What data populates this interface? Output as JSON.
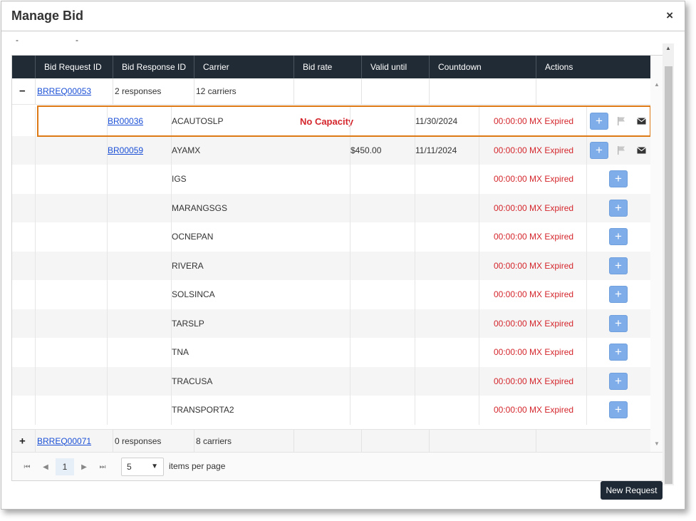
{
  "dialog": {
    "title": "Manage Bid",
    "close_symbol": "×",
    "dash_a": "-",
    "dash_b": "-"
  },
  "grid": {
    "columns": [
      "Bid Request ID",
      "Bid Response ID",
      "Carrier",
      "Bid rate",
      "Valid until",
      "Countdown",
      "Actions"
    ],
    "group1": {
      "toggle": "−",
      "request_id": "BRREQ00053",
      "responses": "2 responses",
      "carriers": "12 carriers"
    },
    "group2": {
      "toggle": "+",
      "request_id": "BRREQ00071",
      "responses": "0 responses",
      "carriers": "8 carriers"
    },
    "detail_rows": [
      {
        "response_id": "BR00036",
        "carrier": "ACAUTOSLP",
        "status": "No Capacity",
        "bid_rate": "",
        "valid_until": "11/30/2024",
        "countdown": "00:00:00 MX Expired",
        "add": "+"
      },
      {
        "response_id": "BR00059",
        "carrier": "AYAMX",
        "status": "",
        "bid_rate": "$450.00",
        "valid_until": "11/11/2024",
        "countdown": "00:00:00 MX Expired",
        "add": "+"
      },
      {
        "response_id": "",
        "carrier": "IGS",
        "status": "",
        "bid_rate": "",
        "valid_until": "",
        "countdown": "00:00:00 MX Expired",
        "add": "+"
      },
      {
        "response_id": "",
        "carrier": "MARANGSGS",
        "status": "",
        "bid_rate": "",
        "valid_until": "",
        "countdown": "00:00:00 MX Expired",
        "add": "+"
      },
      {
        "response_id": "",
        "carrier": "OCNEPAN",
        "status": "",
        "bid_rate": "",
        "valid_until": "",
        "countdown": "00:00:00 MX Expired",
        "add": "+"
      },
      {
        "response_id": "",
        "carrier": "RIVERA",
        "status": "",
        "bid_rate": "",
        "valid_until": "",
        "countdown": "00:00:00 MX Expired",
        "add": "+"
      },
      {
        "response_id": "",
        "carrier": "SOLSINCA",
        "status": "",
        "bid_rate": "",
        "valid_until": "",
        "countdown": "00:00:00 MX Expired",
        "add": "+"
      },
      {
        "response_id": "",
        "carrier": "TARSLP",
        "status": "",
        "bid_rate": "",
        "valid_until": "",
        "countdown": "00:00:00 MX Expired",
        "add": "+"
      },
      {
        "response_id": "",
        "carrier": "TNA",
        "status": "",
        "bid_rate": "",
        "valid_until": "",
        "countdown": "00:00:00 MX Expired",
        "add": "+"
      },
      {
        "response_id": "",
        "carrier": "TRACUSA",
        "status": "",
        "bid_rate": "",
        "valid_until": "",
        "countdown": "00:00:00 MX Expired",
        "add": "+"
      },
      {
        "response_id": "",
        "carrier": "TRANSPORTA2",
        "status": "",
        "bid_rate": "",
        "valid_until": "",
        "countdown": "00:00:00 MX Expired",
        "add": "+"
      }
    ]
  },
  "pager": {
    "first": "⏮",
    "prev": "◀",
    "current_page": "1",
    "next": "▶",
    "last": "⏭",
    "page_size": "5",
    "caret": "▼",
    "per_page_label": "items per page"
  },
  "actions": {
    "new_request_label": "New Request"
  },
  "colors": {
    "header_bg": "#212b35",
    "link": "#1a4fd6",
    "expired": "#d4262c",
    "highlight": "#de7a16",
    "add_button": "#7fadea"
  }
}
